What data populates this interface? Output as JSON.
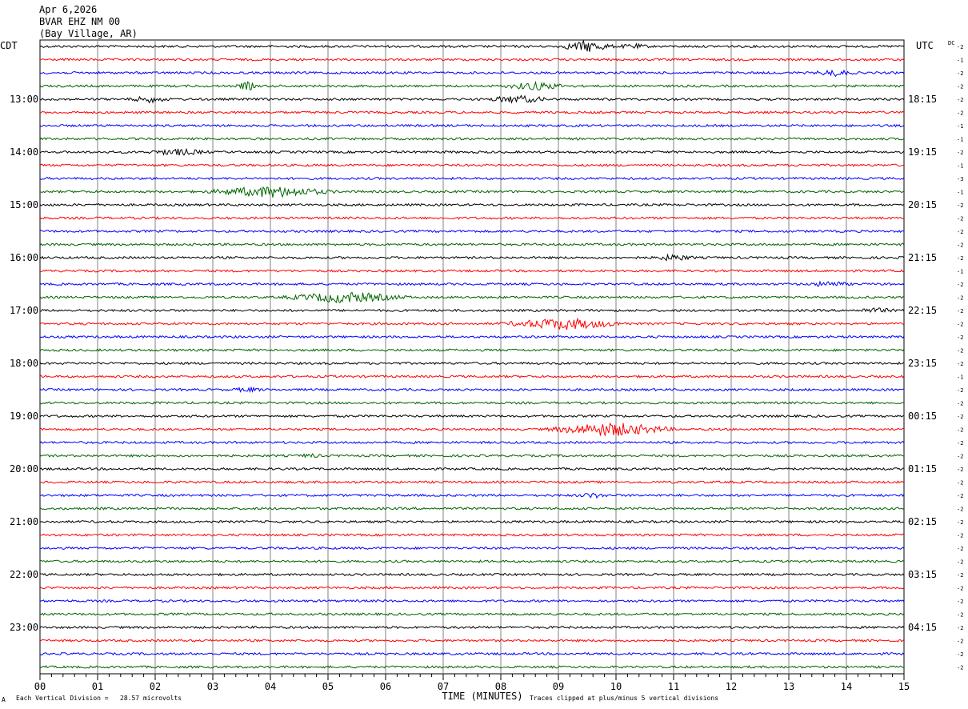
{
  "header": {
    "date": "Apr 6,2026",
    "station": "BVAR EHZ NM 00",
    "location": "(Bay Village, AR)"
  },
  "left_zone_label": "CDT",
  "right_zone_label": "UTC",
  "dc_label": "DC",
  "footer": {
    "scale_note": "Each Vertical Division =   28.57 microvolts",
    "clip_note": "Traces clipped at plus/minus 5 vertical divisions",
    "corner_mark": "A"
  },
  "colors": {
    "trace_cycle": [
      "#000000",
      "#ff0000",
      "#0000ff",
      "#006400"
    ],
    "grid": "#808080"
  },
  "chart_data": {
    "type": "line",
    "xlabel": "TIME (MINUTES)",
    "xlim": [
      0,
      15
    ],
    "x_ticks": [
      "00",
      "01",
      "02",
      "03",
      "04",
      "05",
      "06",
      "07",
      "08",
      "09",
      "10",
      "11",
      "12",
      "13",
      "14",
      "15"
    ],
    "row_count": 48,
    "left_hour_labels": [
      {
        "row": 4,
        "label": "13:00"
      },
      {
        "row": 8,
        "label": "14:00"
      },
      {
        "row": 12,
        "label": "15:00"
      },
      {
        "row": 16,
        "label": "16:00"
      },
      {
        "row": 20,
        "label": "17:00"
      },
      {
        "row": 24,
        "label": "18:00"
      },
      {
        "row": 28,
        "label": "19:00"
      },
      {
        "row": 32,
        "label": "20:00"
      },
      {
        "row": 36,
        "label": "21:00"
      },
      {
        "row": 40,
        "label": "22:00"
      },
      {
        "row": 44,
        "label": "23:00"
      }
    ],
    "right_hour_labels": [
      {
        "row": 4,
        "label": "18:15"
      },
      {
        "row": 8,
        "label": "19:15"
      },
      {
        "row": 12,
        "label": "20:15"
      },
      {
        "row": 16,
        "label": "21:15"
      },
      {
        "row": 20,
        "label": "22:15"
      },
      {
        "row": 24,
        "label": "23:15"
      },
      {
        "row": 28,
        "label": "00:15"
      },
      {
        "row": 32,
        "label": "01:15"
      },
      {
        "row": 36,
        "label": "02:15"
      },
      {
        "row": 40,
        "label": "03:15"
      },
      {
        "row": 44,
        "label": "04:15"
      }
    ],
    "dc_offsets": [
      "-2",
      "-1",
      "-2",
      "-2",
      "-2",
      "-2",
      "-1",
      "-1",
      "-2",
      "-1",
      "-3",
      "-1",
      "-2",
      "-2",
      "-2",
      "-2",
      "-2",
      "-1",
      "-2",
      "-2",
      "-2",
      "-2",
      "-2",
      "-2",
      "-2",
      "-1",
      "-2",
      "-2",
      "-2",
      "-2",
      "-2",
      "-2",
      "-2",
      "-2",
      "-2",
      "-2",
      "-2",
      "-2",
      "-2",
      "-2",
      "-2",
      "-2",
      "-2",
      "-2",
      "-2",
      "-2",
      "-2",
      "-2"
    ],
    "events": [
      {
        "row": 0,
        "minute": 9.5,
        "amplitude": 1.6,
        "duration": 0.5
      },
      {
        "row": 0,
        "minute": 10.3,
        "amplitude": 0.6,
        "duration": 0.3
      },
      {
        "row": 2,
        "minute": 13.8,
        "amplitude": 0.8,
        "duration": 0.4
      },
      {
        "row": 3,
        "minute": 3.6,
        "amplitude": 1.2,
        "duration": 0.2
      },
      {
        "row": 3,
        "minute": 8.6,
        "amplitude": 1.1,
        "duration": 0.6
      },
      {
        "row": 4,
        "minute": 1.9,
        "amplitude": 0.8,
        "duration": 0.4
      },
      {
        "row": 4,
        "minute": 8.3,
        "amplitude": 1.0,
        "duration": 0.6
      },
      {
        "row": 8,
        "minute": 2.4,
        "amplitude": 0.8,
        "duration": 0.6
      },
      {
        "row": 11,
        "minute": 4.0,
        "amplitude": 1.6,
        "duration": 1.2
      },
      {
        "row": 16,
        "minute": 11.0,
        "amplitude": 0.8,
        "duration": 0.4
      },
      {
        "row": 18,
        "minute": 13.7,
        "amplitude": 0.7,
        "duration": 0.4
      },
      {
        "row": 19,
        "minute": 5.3,
        "amplitude": 1.5,
        "duration": 1.2
      },
      {
        "row": 20,
        "minute": 14.5,
        "amplitude": 0.6,
        "duration": 0.4
      },
      {
        "row": 21,
        "minute": 9.1,
        "amplitude": 1.6,
        "duration": 1.2
      },
      {
        "row": 26,
        "minute": 3.6,
        "amplitude": 0.5,
        "duration": 0.3
      },
      {
        "row": 29,
        "minute": 9.9,
        "amplitude": 2.0,
        "duration": 1.2
      },
      {
        "row": 31,
        "minute": 4.7,
        "amplitude": 0.5,
        "duration": 0.2
      },
      {
        "row": 34,
        "minute": 9.6,
        "amplitude": 0.6,
        "duration": 0.3
      }
    ]
  }
}
